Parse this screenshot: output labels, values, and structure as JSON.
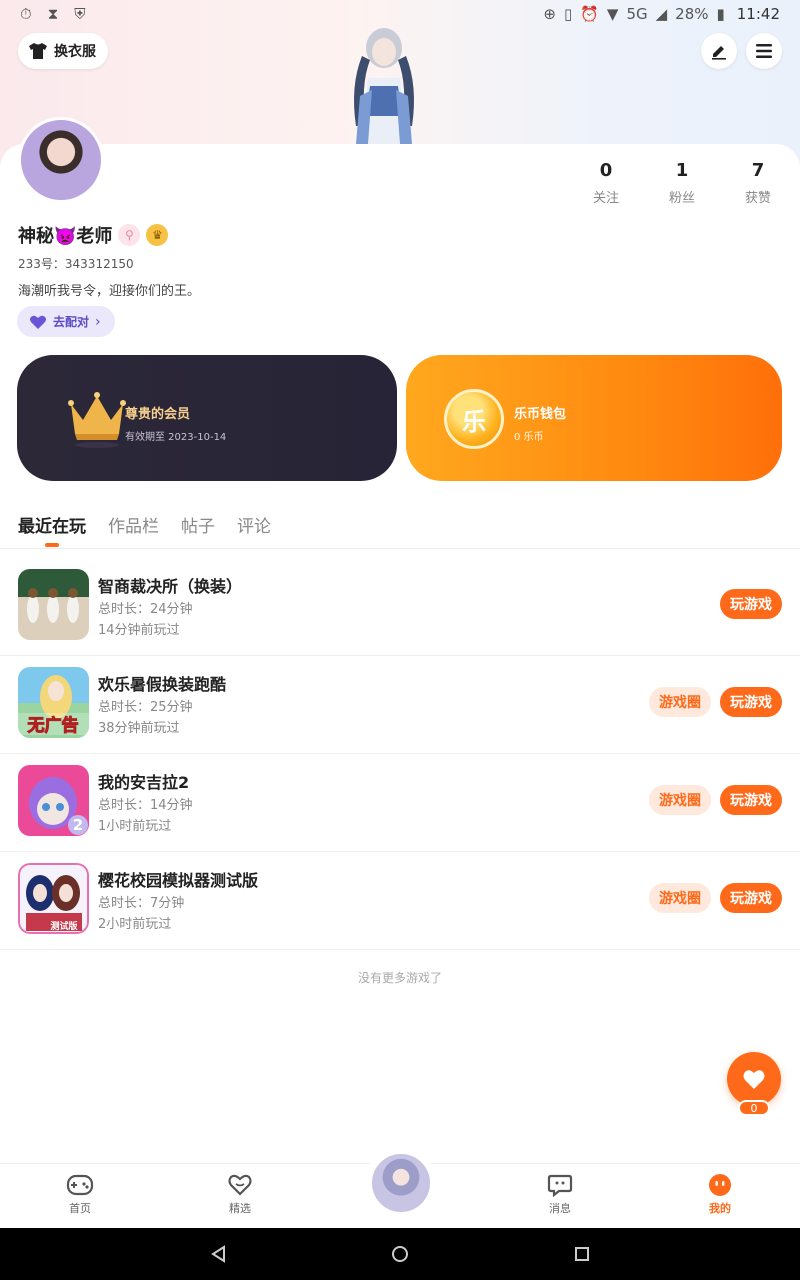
{
  "status_bar": {
    "battery": "28%",
    "network": "5G",
    "time": "11:42"
  },
  "header": {
    "dress_label": "换衣服"
  },
  "profile": {
    "stats": [
      {
        "num": "0",
        "label": "关注"
      },
      {
        "num": "1",
        "label": "粉丝"
      },
      {
        "num": "7",
        "label": "获赞"
      }
    ],
    "name": "神秘👿老师",
    "uid": "233号：343312150",
    "bio": "海潮听我号令，迎接你们的王。",
    "pair_label": "去配对"
  },
  "cards": {
    "vip": {
      "title": "尊贵的会员",
      "sub": "有效期至 2023-10-14"
    },
    "wallet": {
      "title": "乐币钱包",
      "sub": "0 乐币",
      "coin_char": "乐"
    }
  },
  "tabs": [
    "最近在玩",
    "作品栏",
    "帖子",
    "评论"
  ],
  "games": [
    {
      "name": "智商裁决所（换装）",
      "duration": "总时长：24分钟",
      "last": "14分钟前玩过",
      "has_circle": false
    },
    {
      "name": "欢乐暑假换装跑酷",
      "duration": "总时长：25分钟",
      "last": "38分钟前玩过",
      "has_circle": true
    },
    {
      "name": "我的安吉拉2",
      "duration": "总时长：14分钟",
      "last": "1小时前玩过",
      "has_circle": true
    },
    {
      "name": "樱花校园模拟器测试版",
      "duration": "总时长：7分钟",
      "last": "2小时前玩过",
      "has_circle": true
    }
  ],
  "game_buttons": {
    "play": "玩游戏",
    "circle": "游戏圈"
  },
  "game_thumb_texts": {
    "g2": "无广告",
    "g3": "2",
    "g4": "测试版"
  },
  "no_more": "没有更多游戏了",
  "fab_count": "0",
  "bottom_nav": [
    {
      "label": "首页"
    },
    {
      "label": "精选"
    },
    {
      "label": "消息"
    },
    {
      "label": "我的"
    }
  ],
  "colors": {
    "accent": "#ff6a1a",
    "vip_bg": "#2c2838",
    "wallet": "#ff8a10"
  }
}
